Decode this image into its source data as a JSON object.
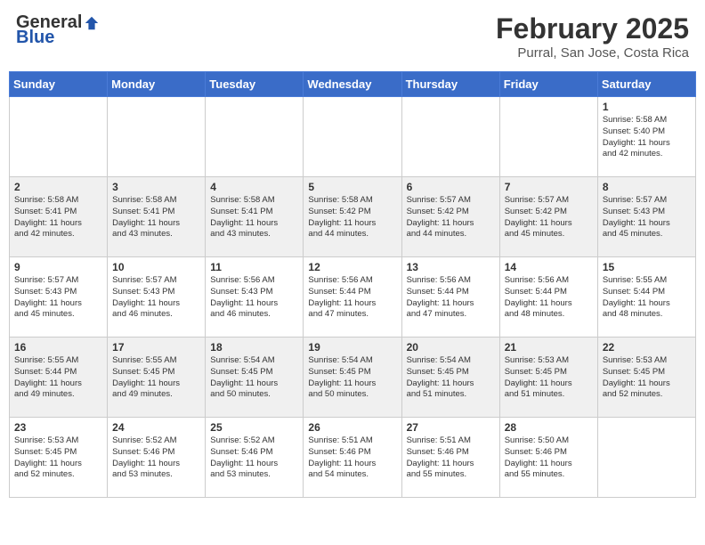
{
  "header": {
    "logo_general": "General",
    "logo_blue": "Blue",
    "month": "February 2025",
    "location": "Purral, San Jose, Costa Rica"
  },
  "days_of_week": [
    "Sunday",
    "Monday",
    "Tuesday",
    "Wednesday",
    "Thursday",
    "Friday",
    "Saturday"
  ],
  "weeks": [
    [
      {
        "day": "",
        "info": ""
      },
      {
        "day": "",
        "info": ""
      },
      {
        "day": "",
        "info": ""
      },
      {
        "day": "",
        "info": ""
      },
      {
        "day": "",
        "info": ""
      },
      {
        "day": "",
        "info": ""
      },
      {
        "day": "1",
        "info": "Sunrise: 5:58 AM\nSunset: 5:40 PM\nDaylight: 11 hours\nand 42 minutes."
      }
    ],
    [
      {
        "day": "2",
        "info": "Sunrise: 5:58 AM\nSunset: 5:41 PM\nDaylight: 11 hours\nand 42 minutes."
      },
      {
        "day": "3",
        "info": "Sunrise: 5:58 AM\nSunset: 5:41 PM\nDaylight: 11 hours\nand 43 minutes."
      },
      {
        "day": "4",
        "info": "Sunrise: 5:58 AM\nSunset: 5:41 PM\nDaylight: 11 hours\nand 43 minutes."
      },
      {
        "day": "5",
        "info": "Sunrise: 5:58 AM\nSunset: 5:42 PM\nDaylight: 11 hours\nand 44 minutes."
      },
      {
        "day": "6",
        "info": "Sunrise: 5:57 AM\nSunset: 5:42 PM\nDaylight: 11 hours\nand 44 minutes."
      },
      {
        "day": "7",
        "info": "Sunrise: 5:57 AM\nSunset: 5:42 PM\nDaylight: 11 hours\nand 45 minutes."
      },
      {
        "day": "8",
        "info": "Sunrise: 5:57 AM\nSunset: 5:43 PM\nDaylight: 11 hours\nand 45 minutes."
      }
    ],
    [
      {
        "day": "9",
        "info": "Sunrise: 5:57 AM\nSunset: 5:43 PM\nDaylight: 11 hours\nand 45 minutes."
      },
      {
        "day": "10",
        "info": "Sunrise: 5:57 AM\nSunset: 5:43 PM\nDaylight: 11 hours\nand 46 minutes."
      },
      {
        "day": "11",
        "info": "Sunrise: 5:56 AM\nSunset: 5:43 PM\nDaylight: 11 hours\nand 46 minutes."
      },
      {
        "day": "12",
        "info": "Sunrise: 5:56 AM\nSunset: 5:44 PM\nDaylight: 11 hours\nand 47 minutes."
      },
      {
        "day": "13",
        "info": "Sunrise: 5:56 AM\nSunset: 5:44 PM\nDaylight: 11 hours\nand 47 minutes."
      },
      {
        "day": "14",
        "info": "Sunrise: 5:56 AM\nSunset: 5:44 PM\nDaylight: 11 hours\nand 48 minutes."
      },
      {
        "day": "15",
        "info": "Sunrise: 5:55 AM\nSunset: 5:44 PM\nDaylight: 11 hours\nand 48 minutes."
      }
    ],
    [
      {
        "day": "16",
        "info": "Sunrise: 5:55 AM\nSunset: 5:44 PM\nDaylight: 11 hours\nand 49 minutes."
      },
      {
        "day": "17",
        "info": "Sunrise: 5:55 AM\nSunset: 5:45 PM\nDaylight: 11 hours\nand 49 minutes."
      },
      {
        "day": "18",
        "info": "Sunrise: 5:54 AM\nSunset: 5:45 PM\nDaylight: 11 hours\nand 50 minutes."
      },
      {
        "day": "19",
        "info": "Sunrise: 5:54 AM\nSunset: 5:45 PM\nDaylight: 11 hours\nand 50 minutes."
      },
      {
        "day": "20",
        "info": "Sunrise: 5:54 AM\nSunset: 5:45 PM\nDaylight: 11 hours\nand 51 minutes."
      },
      {
        "day": "21",
        "info": "Sunrise: 5:53 AM\nSunset: 5:45 PM\nDaylight: 11 hours\nand 51 minutes."
      },
      {
        "day": "22",
        "info": "Sunrise: 5:53 AM\nSunset: 5:45 PM\nDaylight: 11 hours\nand 52 minutes."
      }
    ],
    [
      {
        "day": "23",
        "info": "Sunrise: 5:53 AM\nSunset: 5:45 PM\nDaylight: 11 hours\nand 52 minutes."
      },
      {
        "day": "24",
        "info": "Sunrise: 5:52 AM\nSunset: 5:46 PM\nDaylight: 11 hours\nand 53 minutes."
      },
      {
        "day": "25",
        "info": "Sunrise: 5:52 AM\nSunset: 5:46 PM\nDaylight: 11 hours\nand 53 minutes."
      },
      {
        "day": "26",
        "info": "Sunrise: 5:51 AM\nSunset: 5:46 PM\nDaylight: 11 hours\nand 54 minutes."
      },
      {
        "day": "27",
        "info": "Sunrise: 5:51 AM\nSunset: 5:46 PM\nDaylight: 11 hours\nand 55 minutes."
      },
      {
        "day": "28",
        "info": "Sunrise: 5:50 AM\nSunset: 5:46 PM\nDaylight: 11 hours\nand 55 minutes."
      },
      {
        "day": "",
        "info": ""
      }
    ]
  ]
}
